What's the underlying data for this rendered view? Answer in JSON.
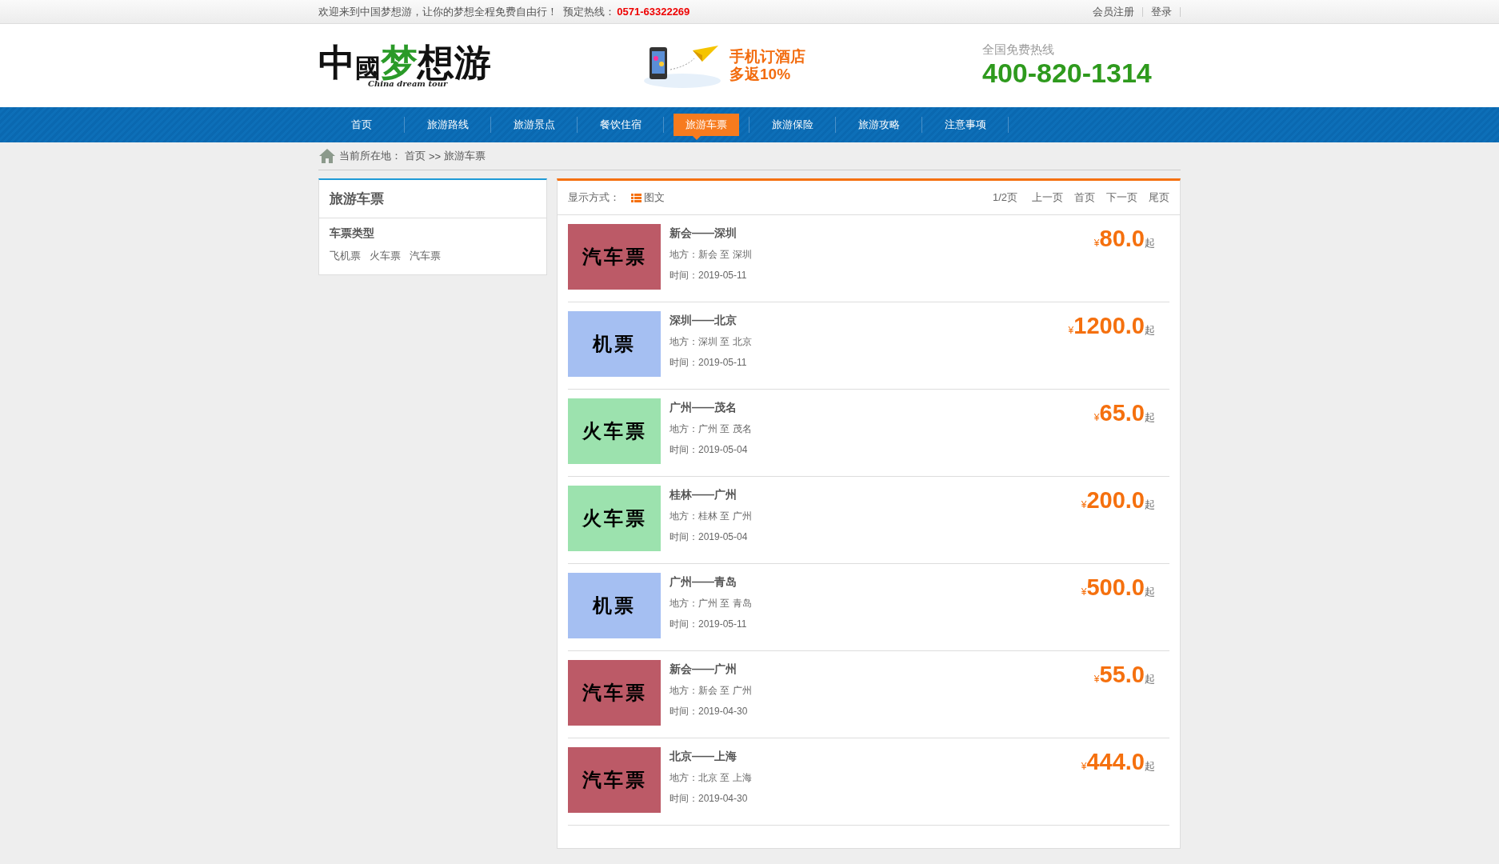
{
  "top_bar": {
    "welcome": "欢迎来到中国梦想游，让你的梦想全程免费自由行！",
    "hotline_label": "预定热线：",
    "hotline": "0571-63322269",
    "links": [
      "会员注册",
      "登录"
    ]
  },
  "header": {
    "logo_chars": [
      "中",
      "國",
      "梦",
      "想",
      "游"
    ],
    "logo_subtitle": "China dream tour",
    "promo_lines": [
      "手机订酒店",
      "多返10%"
    ],
    "hotline_label": "全国免费热线",
    "hotline": "400-820-1314"
  },
  "nav": [
    {
      "label": "首页",
      "selected": false
    },
    {
      "label": "旅游路线",
      "selected": false
    },
    {
      "label": "旅游景点",
      "selected": false
    },
    {
      "label": "餐饮住宿",
      "selected": false
    },
    {
      "label": "旅游车票",
      "selected": true
    },
    {
      "label": "旅游保险",
      "selected": false
    },
    {
      "label": "旅游攻略",
      "selected": false
    },
    {
      "label": "注意事项",
      "selected": false
    }
  ],
  "breadcrumb": {
    "label": "当前所在地：",
    "items": [
      "首页",
      "旅游车票"
    ],
    "separator": ">>"
  },
  "sidebar": {
    "title": "旅游车票",
    "section": "车票类型",
    "types": [
      "飞机票",
      "火车票",
      "汽车票"
    ]
  },
  "list": {
    "display_label": "显示方式：",
    "display_mode": "图文",
    "page": "1/2页",
    "pager": [
      "上一页",
      "首页",
      "下一页",
      "尾页"
    ],
    "items": [
      {
        "image_label": "汽车票",
        "color": "#bc5a67",
        "title": "新会——深圳",
        "place": "地方：新会 至 深圳",
        "time": "时间：2019-05-11",
        "currency": "¥",
        "price": "80.0",
        "suffix": "起"
      },
      {
        "image_label": "机票",
        "color": "#a5bff2",
        "title": "深圳——北京",
        "place": "地方：深圳 至 北京",
        "time": "时间：2019-05-11",
        "currency": "¥",
        "price": "1200.0",
        "suffix": "起"
      },
      {
        "image_label": "火车票",
        "color": "#9ce2ae",
        "title": "广州——茂名",
        "place": "地方：广州 至 茂名",
        "time": "时间：2019-05-04",
        "currency": "¥",
        "price": "65.0",
        "suffix": "起"
      },
      {
        "image_label": "火车票",
        "color": "#9ce2ae",
        "title": "桂林——广州",
        "place": "地方：桂林 至 广州",
        "time": "时间：2019-05-04",
        "currency": "¥",
        "price": "200.0",
        "suffix": "起"
      },
      {
        "image_label": "机票",
        "color": "#a5bff2",
        "title": "广州——青岛",
        "place": "地方：广州 至 青岛",
        "time": "时间：2019-05-11",
        "currency": "¥",
        "price": "500.0",
        "suffix": "起"
      },
      {
        "image_label": "汽车票",
        "color": "#bc5a67",
        "title": "新会——广州",
        "place": "地方：新会 至 广州",
        "time": "时间：2019-04-30",
        "currency": "¥",
        "price": "55.0",
        "suffix": "起"
      },
      {
        "image_label": "汽车票",
        "color": "#bc5a67",
        "title": "北京——上海",
        "place": "地方：北京 至 上海",
        "time": "时间：2019-04-30",
        "currency": "¥",
        "price": "444.0",
        "suffix": "起"
      }
    ]
  }
}
